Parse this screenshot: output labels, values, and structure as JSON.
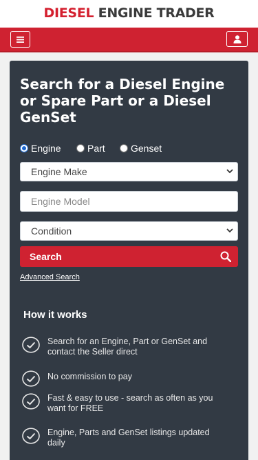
{
  "brand": {
    "word1": "DIESEL",
    "word2": "ENGINE TRADER"
  },
  "nav": {
    "menu_icon": "hamburger-icon",
    "user_icon": "user-icon"
  },
  "search_card": {
    "title": "Search for a Diesel Engine or Spare Part or a Diesel GenSet",
    "radios": [
      {
        "label": "Engine",
        "checked": true
      },
      {
        "label": "Part",
        "checked": false
      },
      {
        "label": "Genset",
        "checked": false
      }
    ],
    "make_select": "Engine Make",
    "model_placeholder": "Engine Model",
    "condition_select": "Condition",
    "search_label": "Search",
    "advanced_link": "Advanced Search"
  },
  "how_it_works": {
    "title": "How it works",
    "steps": [
      "Search for an Engine, Part or GenSet and contact the Seller direct",
      "No commission to pay",
      "Fast & easy to use - search as often as you want for FREE",
      "Engine, Parts and GenSet listings updated daily"
    ]
  },
  "colors": {
    "brand_red": "#cf2231",
    "card_bg": "#323a44",
    "page_bg": "#f1f1f1"
  }
}
